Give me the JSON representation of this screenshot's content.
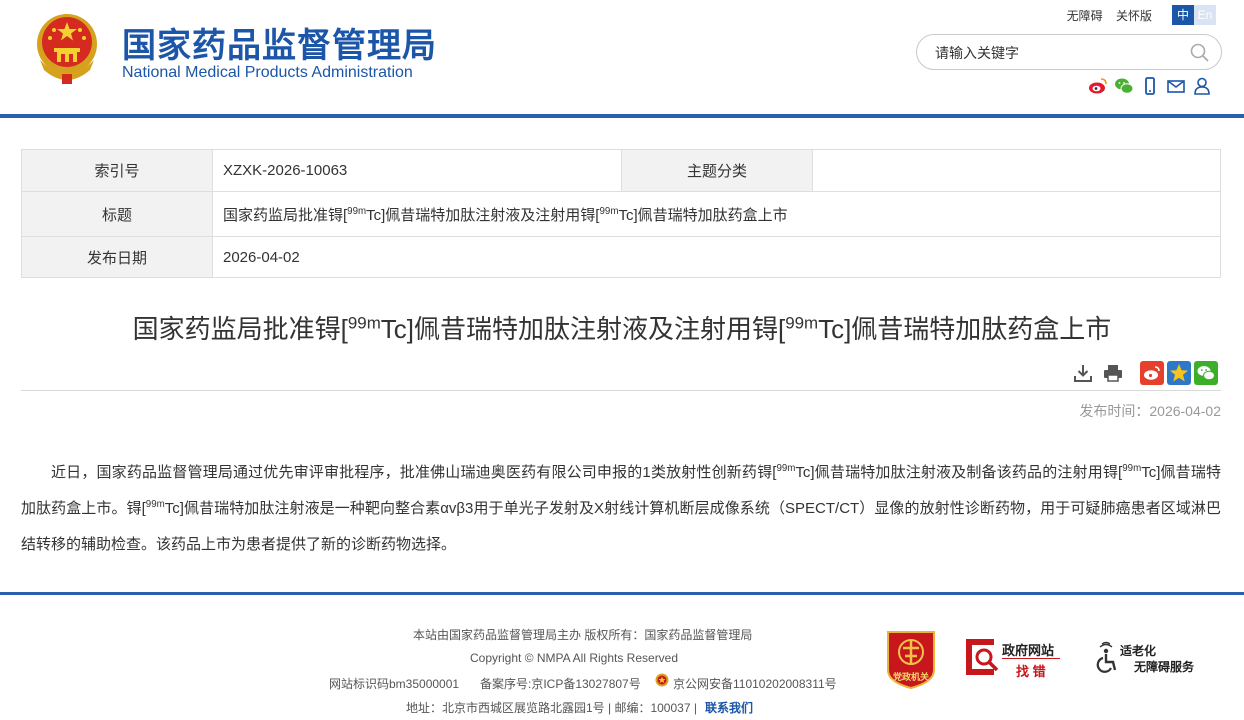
{
  "header": {
    "site_name_cn": "国家药品监督管理局",
    "site_name_en": "National Medical Products Administration",
    "accessibility_link": "无障碍",
    "traditional_link": "关怀版",
    "lang_zh": "中",
    "lang_en": "En",
    "search_placeholder": "请输入关键字"
  },
  "info": {
    "index_label": "索引号",
    "index_value": "XZXK-2026-10063",
    "category_label": "主题分类",
    "category_value": "",
    "title_label": "标题",
    "title_pre": "国家药监局批准锝[",
    "title_sup1": "99m",
    "title_mid": "Tc]佩昔瑞特加肽注射液及注射用锝[",
    "title_sup2": "99m",
    "title_post": "Tc]佩昔瑞特加肽药盒上市",
    "date_label": "发布日期",
    "date_value": "2026-04-02"
  },
  "article": {
    "title_pre": "国家药监局批准锝[",
    "title_sup1": "99m",
    "title_mid": "Tc]佩昔瑞特加肽注射液及注射用锝[",
    "title_sup2": "99m",
    "title_post": "Tc]佩昔瑞特加肽药盒上市",
    "pub_date": "发布时间：2026-04-02",
    "p1": "近日，国家药品监督管理局通过优先审评审批程序，批准佛山瑞迪奥医药有限公司申报的1类放射性创新药锝[",
    "p1_sup1": "99m",
    "p2": "Tc]佩昔瑞特加肽注射液及制备该药品的注射用锝[",
    "p2_sup2": "99m",
    "p3": "Tc]佩昔瑞特加肽药盒上市。锝[",
    "p3_sup3": "99m",
    "p4": "Tc]佩昔瑞特加肽注射液是一种靶向整合素αvβ3用于单光子发射及X射线计算机断层成像系统（SPECT/CT）显像的放射性诊断药物，用于可疑肺癌患者区域淋巴结转移的辅助检查。该药品上市为患者提供了新的诊断药物选择。"
  },
  "footer": {
    "sponsor": "本站由国家药品监督管理局主办 版权所有：国家药品监督管理局",
    "copyright": "Copyright © NMPA All Rights Reserved",
    "site_id": "网站标识码bm35000001",
    "icp": "备案序号:京ICP备13027807号",
    "police": "京公网安备11010202008311号",
    "address": "地址：北京市西城区展览路北露园1号 | 邮编：100037 |",
    "contact": "联系我们",
    "gov_find_1": "政府网站",
    "gov_find_2": "找 错",
    "elder_1": "适老化",
    "elder_2": "无障碍服务",
    "badge_text": "党政机关"
  },
  "colors": {
    "brand_blue": "#1b56a8",
    "header_line": "#2a5fae",
    "red": "#c8161d"
  }
}
